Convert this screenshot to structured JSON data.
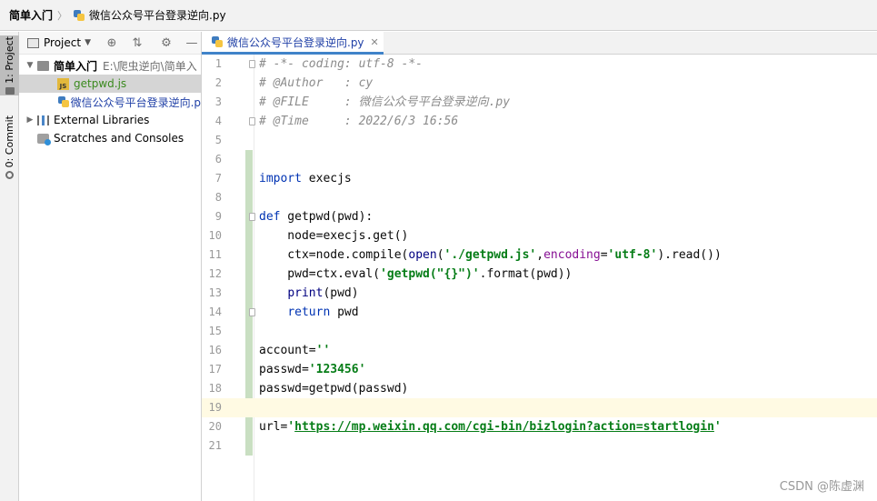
{
  "breadcrumb": {
    "project": "简单入门",
    "file": "微信公众号平台登录逆向.py"
  },
  "toolstrip": {
    "project_tab": "1: Project",
    "commit_tab": "0: Commit"
  },
  "project_panel": {
    "title": "Project",
    "tree": [
      {
        "name": "简单入门",
        "path": "E:\\爬虫逆向\\简单入",
        "type": "folder",
        "expanded": true
      },
      {
        "name": "getpwd.js",
        "type": "js",
        "selected": true
      },
      {
        "name": "微信公众号平台登录逆向.p",
        "type": "py"
      },
      {
        "name": "External Libraries",
        "type": "lib"
      },
      {
        "name": "Scratches and Consoles",
        "type": "scratch"
      }
    ]
  },
  "editor": {
    "tab_label": "微信公众号平台登录逆向.py",
    "current_line": 19,
    "lines": [
      {
        "n": "1",
        "t": "# -*- coding: utf-8 -*-"
      },
      {
        "n": "2",
        "t": "# @Author   : cy"
      },
      {
        "n": "3",
        "t": "# @FILE     : 微信公众号平台登录逆向.py"
      },
      {
        "n": "4",
        "t": "# @Time     : 2022/6/3 16:56"
      },
      {
        "n": "5",
        "t": ""
      },
      {
        "n": "6",
        "t": ""
      },
      {
        "n": "7",
        "t": "import execjs"
      },
      {
        "n": "8",
        "t": ""
      },
      {
        "n": "9",
        "t": "def getpwd(pwd):"
      },
      {
        "n": "10",
        "t": "    node=execjs.get()"
      },
      {
        "n": "11",
        "t": "    ctx=node.compile(open('./getpwd.js',encoding='utf-8').read())"
      },
      {
        "n": "12",
        "t": "    pwd=ctx.eval('getpwd(\"{}\")'.format(pwd))"
      },
      {
        "n": "13",
        "t": "    print(pwd)"
      },
      {
        "n": "14",
        "t": "    return pwd"
      },
      {
        "n": "15",
        "t": ""
      },
      {
        "n": "16",
        "t": "account=''"
      },
      {
        "n": "17",
        "t": "passwd='123456'"
      },
      {
        "n": "18",
        "t": "passwd=getpwd(passwd)"
      },
      {
        "n": "19",
        "t": ""
      },
      {
        "n": "20",
        "t": "url='https://mp.weixin.qq.com/cgi-bin/bizlogin?action=startlogin'"
      },
      {
        "n": "21",
        "t": ""
      }
    ]
  },
  "watermark": "CSDN @陈虚渊"
}
